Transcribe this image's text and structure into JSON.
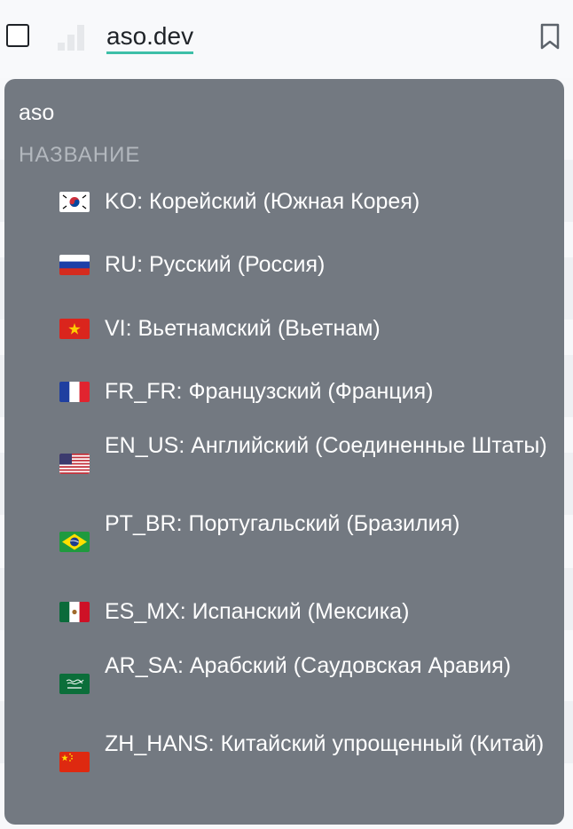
{
  "header": {
    "domain": "aso.dev"
  },
  "popup": {
    "query": "aso",
    "section_label": "НАЗВАНИЕ",
    "items": [
      {
        "label": "KO: Корейский (Южная Корея)",
        "flag_icon": "south-korea-flag-icon"
      },
      {
        "label": "RU: Русский (Россия)",
        "flag_icon": "russia-flag-icon"
      },
      {
        "label": "VI: Вьетнамский (Вьетнам)",
        "flag_icon": "vietnam-flag-icon"
      },
      {
        "label": "FR_FR: Французский (Франция)",
        "flag_icon": "france-flag-icon"
      },
      {
        "label": "EN_US: Английский (Соединенные Штаты)",
        "flag_icon": "usa-flag-icon"
      },
      {
        "label": "PT_BR: Португальский (Бразилия)",
        "flag_icon": "brazil-flag-icon"
      },
      {
        "label": "ES_MX: Испанский (Мексика)",
        "flag_icon": "mexico-flag-icon"
      },
      {
        "label": "AR_SA: Арабский (Саудовская Аравия)",
        "flag_icon": "saudi-arabia-flag-icon"
      },
      {
        "label": "ZH_HANS: Китайский упрощенный (Китай)",
        "flag_icon": "china-flag-icon"
      }
    ]
  },
  "colors": {
    "popup_bg": "#737981",
    "accent_underline": "#3dbfa8",
    "section_text": "#b3b8be"
  }
}
